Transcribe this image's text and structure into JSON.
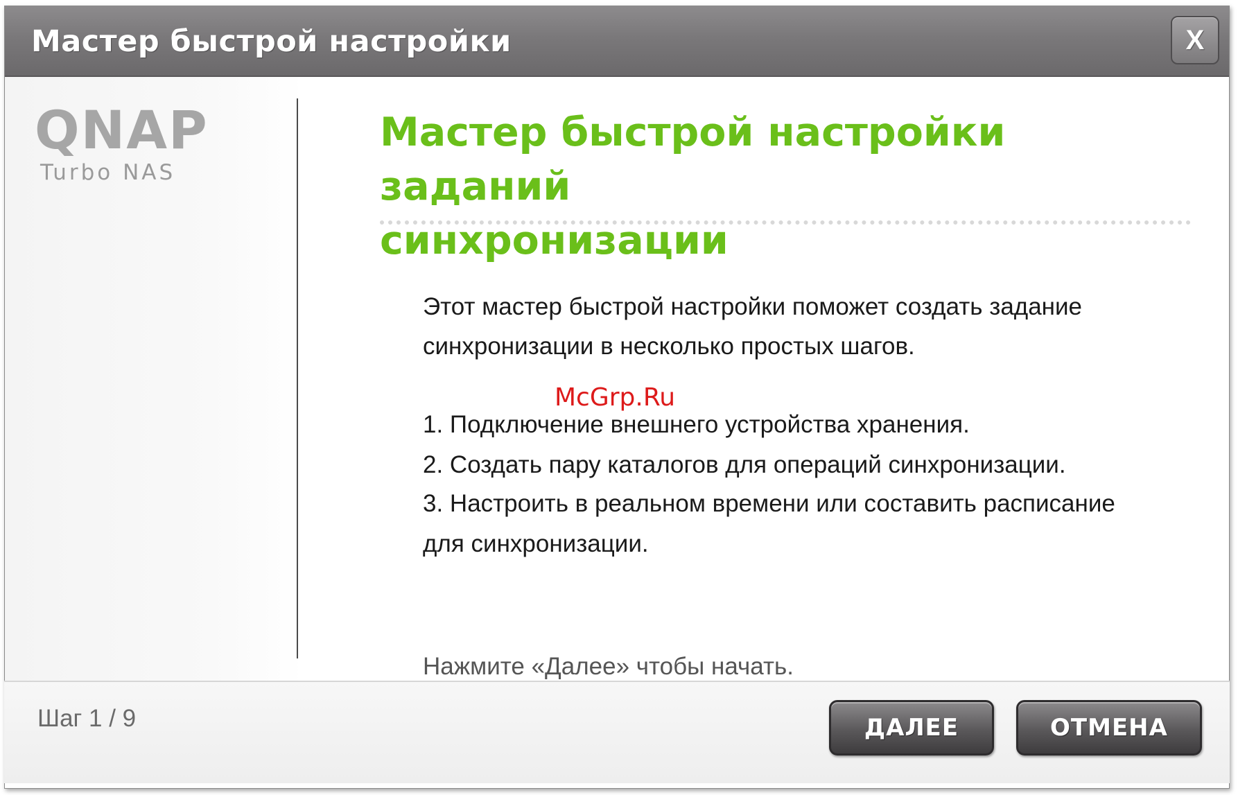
{
  "window": {
    "title": "Мастер быстрой настройки",
    "close_label": "X"
  },
  "logo": {
    "brand": "QNAP",
    "subtitle": "Turbo NAS"
  },
  "content": {
    "heading_line1": "Мастер быстрой настройки заданий",
    "heading_line2": "синхронизации",
    "intro_line1": "Этот мастер быстрой настройки поможет создать задание",
    "intro_line2": "синхронизации в несколько простых шагов.",
    "step1": "1. Подключение внешнего устройства хранения.",
    "step2": "2. Создать пару каталогов для операций синхронизации.",
    "step3_line1": "3. Настроить в реальном времени или составить расписание",
    "step3_line2": "для синхронизации.",
    "prompt": "Нажмите «Далее» чтобы начать.",
    "watermark": "McGrp.Ru"
  },
  "footer": {
    "step_indicator": "Шаг 1 / 9",
    "next_label": "ДАЛЕЕ",
    "cancel_label": "ОТМЕНА"
  },
  "colors": {
    "heading": "#6abf1a",
    "titlebar": "#7a787a",
    "button": "#5a585a"
  }
}
